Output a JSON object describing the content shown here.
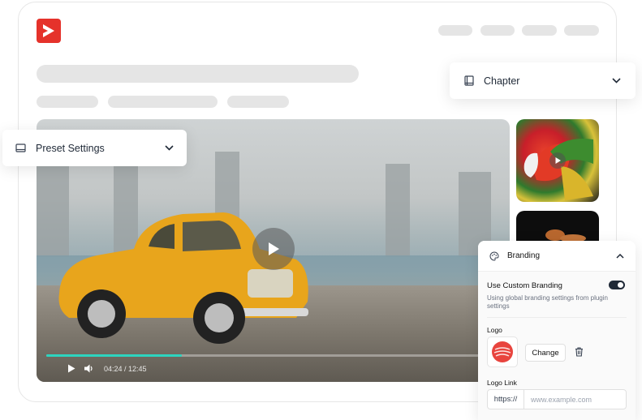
{
  "chapter_dropdown": {
    "label": "Chapter"
  },
  "preset_dropdown": {
    "label": "Preset Settings"
  },
  "player": {
    "time": "04:24 / 12:45"
  },
  "branding": {
    "header": "Branding",
    "custom_label": "Use Custom Branding",
    "custom_enabled": true,
    "description": "Using global branding settings from plugin settings",
    "logo_label": "Logo",
    "change_label": "Change",
    "logo_link_label": "Logo Link",
    "url_prefix": "https://",
    "url_placeholder": "www.example.com"
  },
  "colors": {
    "brand": "#e5322b",
    "progress": "#2dd4bf",
    "toggle": "#1f2937"
  }
}
